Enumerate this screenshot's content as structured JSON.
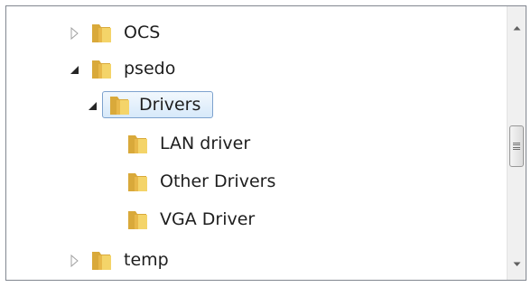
{
  "tree": {
    "nodes": [
      {
        "label": "OCS",
        "state": "collapsed",
        "selected": false
      },
      {
        "label": "psedo",
        "state": "expanded",
        "selected": false
      },
      {
        "label": "Drivers",
        "state": "expanded",
        "selected": true
      },
      {
        "label": "LAN driver",
        "state": "leaf",
        "selected": false
      },
      {
        "label": "Other Drivers",
        "state": "leaf",
        "selected": false
      },
      {
        "label": "VGA Driver",
        "state": "leaf",
        "selected": false
      },
      {
        "label": "temp",
        "state": "collapsed",
        "selected": false
      }
    ]
  },
  "icons": {
    "collapsed_expander": "triangle-right-icon",
    "expanded_expander": "triangle-down-right-icon",
    "folder": "folder-icon",
    "scroll_up": "arrow-up-icon",
    "scroll_down": "arrow-down-icon",
    "thumb_grip": "grip-icon"
  },
  "colors": {
    "folder_yellow": "#e8c24a",
    "selection_border": "#7da2ce",
    "selection_fill": "#dcebfb",
    "border": "#828790"
  }
}
